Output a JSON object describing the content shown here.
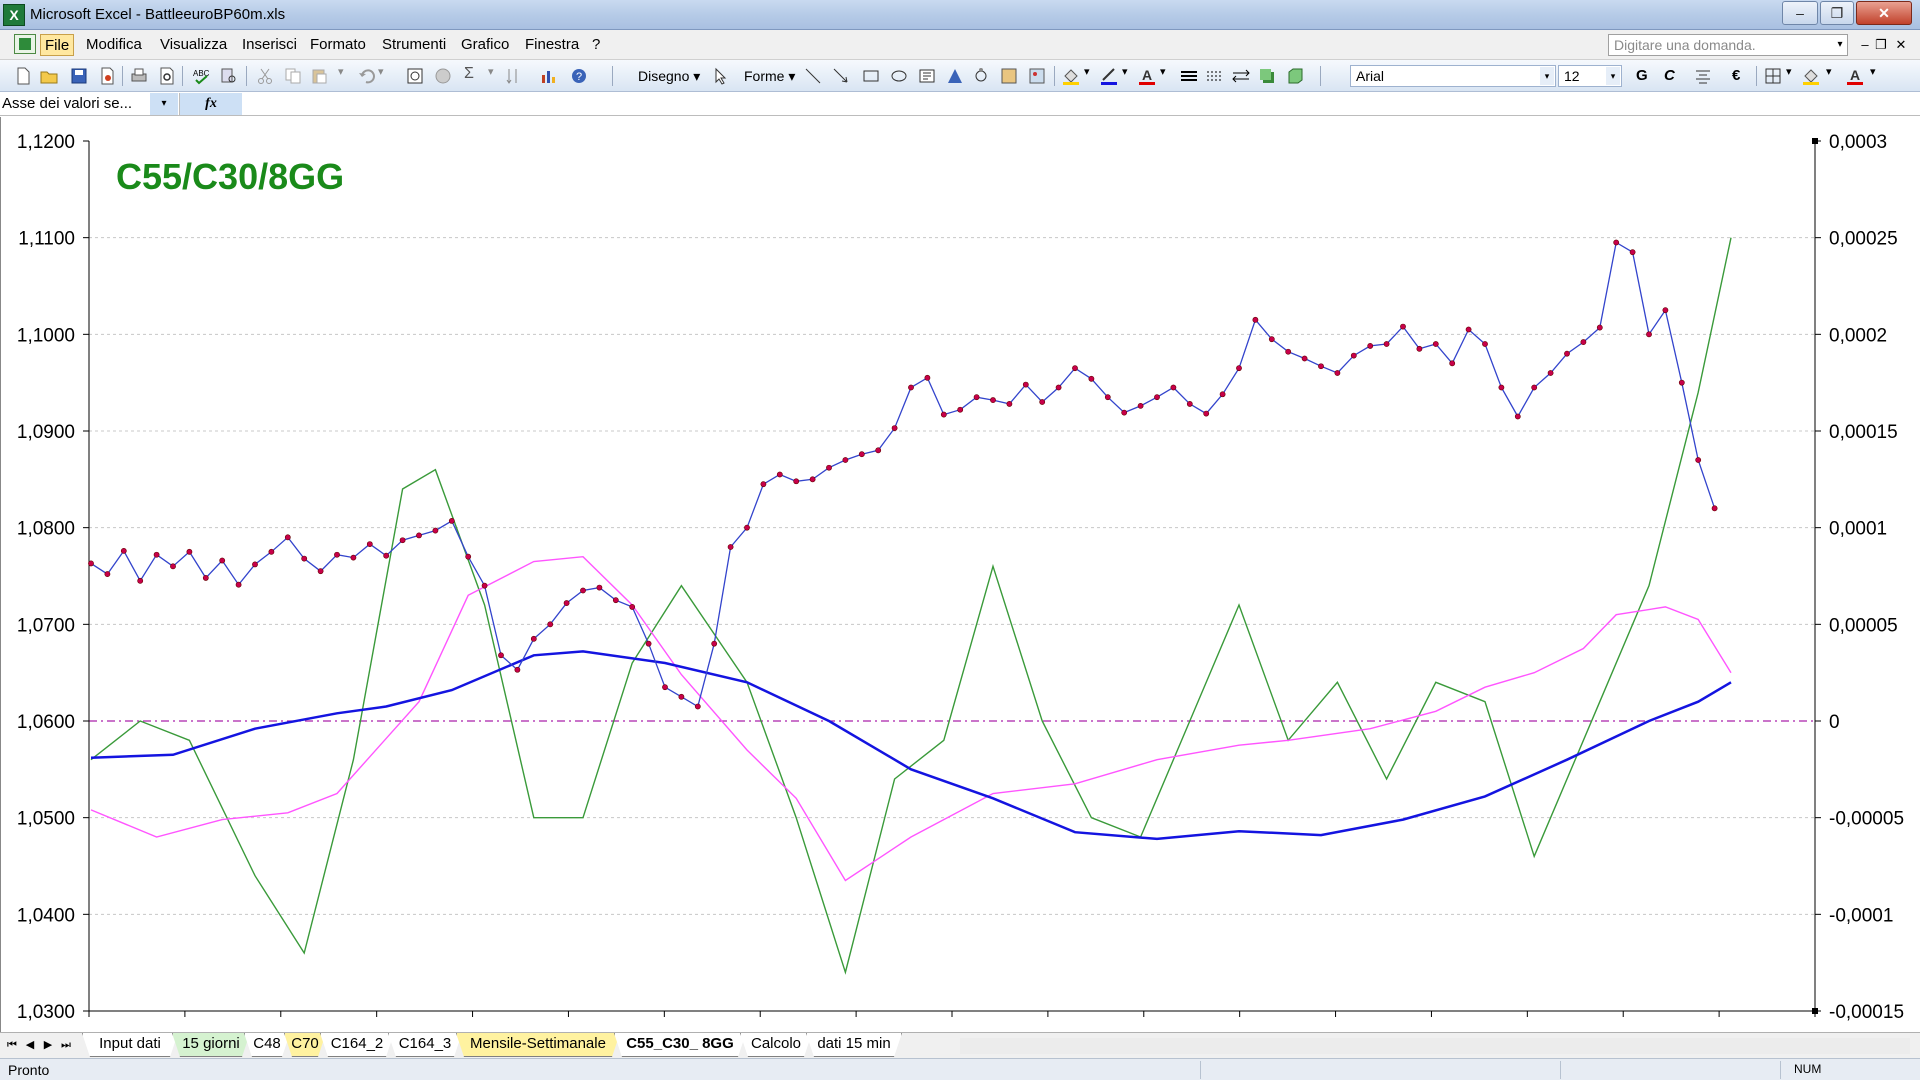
{
  "window": {
    "title": "Microsoft Excel - BattleeuroBP60m.xls",
    "minimize": "–",
    "restore": "❐",
    "close": "✕"
  },
  "menu": {
    "items": [
      "File",
      "Modifica",
      "Visualizza",
      "Inserisci",
      "Formato",
      "Strumenti",
      "Grafico",
      "Finestra",
      "?"
    ],
    "help_placeholder": "Digitare una domanda.",
    "help_drop": "▾",
    "mini_minimize": "–",
    "mini_restore": "❐",
    "mini_close": "✕"
  },
  "toolbar": {
    "drawing_label": "Disegno ▾",
    "shapes_label": "Forme ▾",
    "font_name": "Arial",
    "font_size": "12",
    "bold_label": "G",
    "italic_label": "C",
    "euro_label": "€",
    "drop_arrow": "▾"
  },
  "name_box": {
    "value": "Asse dei valori se...",
    "drop": "▾",
    "fx": "fx"
  },
  "chart": {
    "title": "C55/C30/8GG",
    "colors": {
      "price": "#3344cc",
      "marker": "#c8004a",
      "blue_avg": "#1414e0",
      "magenta_avg": "#ff55ff",
      "green_osc": "#3a9a3a",
      "zero_line": "#aa22aa",
      "grid": "#c8c8c8"
    }
  },
  "chart_data": {
    "type": "line",
    "title": "C55/C30/8GG",
    "y_left": {
      "ticks": [
        "1,1200",
        "1,1100",
        "1,1000",
        "1,0900",
        "1,0800",
        "1,0700",
        "1,0600",
        "1,0500",
        "1,0400",
        "1,0300"
      ],
      "range": [
        1.03,
        1.12
      ]
    },
    "y_right": {
      "ticks": [
        "0,0003",
        "0,00025",
        "0,0002",
        "0,00015",
        "0,0001",
        "0,00005",
        "0",
        "-0,00005",
        "-0,0001",
        "-0,00015"
      ],
      "range": [
        -0.00015,
        0.0003
      ]
    },
    "x_range": [
      0,
      100
    ],
    "grid": true,
    "series": [
      {
        "axis": "left",
        "color": "#3344cc",
        "markers": true,
        "points": [
          [
            0,
            1.0763
          ],
          [
            1,
            1.0752
          ],
          [
            2,
            1.0776
          ],
          [
            3,
            1.0745
          ],
          [
            4,
            1.0772
          ],
          [
            5,
            1.076
          ],
          [
            6,
            1.0775
          ],
          [
            7,
            1.0748
          ],
          [
            8,
            1.0766
          ],
          [
            9,
            1.0741
          ],
          [
            10,
            1.0762
          ],
          [
            11,
            1.0775
          ],
          [
            12,
            1.079
          ],
          [
            13,
            1.0768
          ],
          [
            14,
            1.0755
          ],
          [
            15,
            1.0772
          ],
          [
            16,
            1.0769
          ],
          [
            17,
            1.0783
          ],
          [
            18,
            1.0771
          ],
          [
            19,
            1.0787
          ],
          [
            20,
            1.0792
          ],
          [
            21,
            1.0797
          ],
          [
            22,
            1.0807
          ],
          [
            23,
            1.077
          ],
          [
            24,
            1.074
          ],
          [
            25,
            1.0668
          ],
          [
            26,
            1.0653
          ],
          [
            27,
            1.0685
          ],
          [
            28,
            1.07
          ],
          [
            29,
            1.0722
          ],
          [
            30,
            1.0735
          ],
          [
            31,
            1.0738
          ],
          [
            32,
            1.0725
          ],
          [
            33,
            1.0718
          ],
          [
            34,
            1.068
          ],
          [
            35,
            1.0635
          ],
          [
            36,
            1.0625
          ],
          [
            37,
            1.0615
          ],
          [
            38,
            1.068
          ],
          [
            39,
            1.078
          ],
          [
            40,
            1.08
          ],
          [
            41,
            1.0845
          ],
          [
            42,
            1.0855
          ],
          [
            43,
            1.0848
          ],
          [
            44,
            1.085
          ],
          [
            45,
            1.0862
          ],
          [
            46,
            1.087
          ],
          [
            47,
            1.0876
          ],
          [
            48,
            1.088
          ],
          [
            49,
            1.0903
          ],
          [
            50,
            1.0945
          ],
          [
            51,
            1.0955
          ],
          [
            52,
            1.0917
          ],
          [
            53,
            1.0922
          ],
          [
            54,
            1.0935
          ],
          [
            55,
            1.0932
          ],
          [
            56,
            1.0928
          ],
          [
            57,
            1.0948
          ],
          [
            58,
            1.093
          ],
          [
            59,
            1.0945
          ],
          [
            60,
            1.0965
          ],
          [
            61,
            1.0954
          ],
          [
            62,
            1.0935
          ],
          [
            63,
            1.0919
          ],
          [
            64,
            1.0926
          ],
          [
            65,
            1.0935
          ],
          [
            66,
            1.0945
          ],
          [
            67,
            1.0928
          ],
          [
            68,
            1.0918
          ],
          [
            69,
            1.0938
          ],
          [
            70,
            1.0965
          ],
          [
            71,
            1.1015
          ],
          [
            72,
            1.0995
          ],
          [
            73,
            1.0982
          ],
          [
            74,
            1.0975
          ],
          [
            75,
            1.0967
          ],
          [
            76,
            1.096
          ],
          [
            77,
            1.0978
          ],
          [
            78,
            1.0988
          ],
          [
            79,
            1.099
          ],
          [
            80,
            1.1008
          ],
          [
            81,
            1.0985
          ],
          [
            82,
            1.099
          ],
          [
            83,
            1.097
          ],
          [
            84,
            1.1005
          ],
          [
            85,
            1.099
          ],
          [
            86,
            1.0945
          ],
          [
            87,
            1.0915
          ],
          [
            88,
            1.0945
          ],
          [
            89,
            1.096
          ],
          [
            90,
            1.098
          ],
          [
            91,
            1.0992
          ],
          [
            92,
            1.1007
          ],
          [
            93,
            1.1095
          ],
          [
            94,
            1.1085
          ],
          [
            95,
            1.1
          ],
          [
            96,
            1.1025
          ],
          [
            97,
            1.095
          ],
          [
            98,
            1.087
          ],
          [
            99,
            1.082
          ]
        ]
      },
      {
        "axis": "left",
        "color": "#1414e0",
        "points": [
          [
            0,
            1.0562
          ],
          [
            5,
            1.0565
          ],
          [
            10,
            1.0592
          ],
          [
            15,
            1.0608
          ],
          [
            18,
            1.0615
          ],
          [
            22,
            1.0632
          ],
          [
            27,
            1.0668
          ],
          [
            30,
            1.0672
          ],
          [
            35,
            1.066
          ],
          [
            40,
            1.064
          ],
          [
            45,
            1.06
          ],
          [
            50,
            1.055
          ],
          [
            55,
            1.052
          ],
          [
            60,
            1.0485
          ],
          [
            65,
            1.0478
          ],
          [
            70,
            1.0486
          ],
          [
            75,
            1.0482
          ],
          [
            80,
            1.0498
          ],
          [
            85,
            1.0522
          ],
          [
            90,
            1.056
          ],
          [
            95,
            1.06
          ],
          [
            98,
            1.062
          ],
          [
            100,
            1.064
          ]
        ]
      },
      {
        "axis": "left",
        "color": "#ff55ff",
        "points": [
          [
            0,
            1.0508
          ],
          [
            4,
            1.048
          ],
          [
            8,
            1.0498
          ],
          [
            12,
            1.0505
          ],
          [
            15,
            1.0525
          ],
          [
            20,
            1.062
          ],
          [
            23,
            1.073
          ],
          [
            27,
            1.0765
          ],
          [
            30,
            1.077
          ],
          [
            33,
            1.072
          ],
          [
            36,
            1.0648
          ],
          [
            40,
            1.057
          ],
          [
            43,
            1.052
          ],
          [
            46,
            1.0435
          ],
          [
            50,
            1.048
          ],
          [
            55,
            1.0525
          ],
          [
            60,
            1.0535
          ],
          [
            65,
            1.056
          ],
          [
            70,
            1.0575
          ],
          [
            73,
            1.058
          ],
          [
            78,
            1.0592
          ],
          [
            82,
            1.061
          ],
          [
            85,
            1.0635
          ],
          [
            88,
            1.065
          ],
          [
            91,
            1.0675
          ],
          [
            93,
            1.071
          ],
          [
            96,
            1.0718
          ],
          [
            98,
            1.0705
          ],
          [
            100,
            1.065
          ]
        ]
      },
      {
        "axis": "right",
        "color": "#3a9a3a",
        "points": [
          [
            0,
            -2e-05
          ],
          [
            3,
            0
          ],
          [
            6,
            -1e-05
          ],
          [
            10,
            -8e-05
          ],
          [
            13,
            -0.00012
          ],
          [
            16,
            -2e-05
          ],
          [
            19,
            0.00012
          ],
          [
            21,
            0.00013
          ],
          [
            24,
            6e-05
          ],
          [
            27,
            -5e-05
          ],
          [
            30,
            -5e-05
          ],
          [
            33,
            3e-05
          ],
          [
            36,
            7e-05
          ],
          [
            40,
            2e-05
          ],
          [
            43,
            -5e-05
          ],
          [
            46,
            -0.00013
          ],
          [
            49,
            -3e-05
          ],
          [
            52,
            -1e-05
          ],
          [
            55,
            8e-05
          ],
          [
            58,
            0
          ],
          [
            61,
            -5e-05
          ],
          [
            64,
            -6e-05
          ],
          [
            67,
            0
          ],
          [
            70,
            6e-05
          ],
          [
            73,
            -1e-05
          ],
          [
            76,
            2e-05
          ],
          [
            79,
            -3e-05
          ],
          [
            82,
            2e-05
          ],
          [
            85,
            1e-05
          ],
          [
            88,
            -7e-05
          ],
          [
            92,
            1e-05
          ],
          [
            95,
            7e-05
          ],
          [
            98,
            0.00017
          ],
          [
            100,
            0.00025
          ]
        ]
      }
    ]
  },
  "sheet_tabs": [
    {
      "label": "Input dati",
      "color": "white"
    },
    {
      "label": "15 giorni",
      "color": "green"
    },
    {
      "label": "C48",
      "color": "white"
    },
    {
      "label": "C70",
      "color": "yellow"
    },
    {
      "label": "C164_2",
      "color": "white"
    },
    {
      "label": "C164_3",
      "color": "white"
    },
    {
      "label": "Mensile-Settimanale",
      "color": "yellow"
    },
    {
      "label": "C55_C30_ 8GG",
      "color": "active"
    },
    {
      "label": "Calcolo",
      "color": "white"
    },
    {
      "label": "dati 15 min",
      "color": "white"
    }
  ],
  "tab_nav": {
    "first": "⏮",
    "prev": "◀",
    "next": "▶",
    "last": "⏭"
  },
  "status": {
    "text": "Pronto",
    "num": "NUM"
  }
}
